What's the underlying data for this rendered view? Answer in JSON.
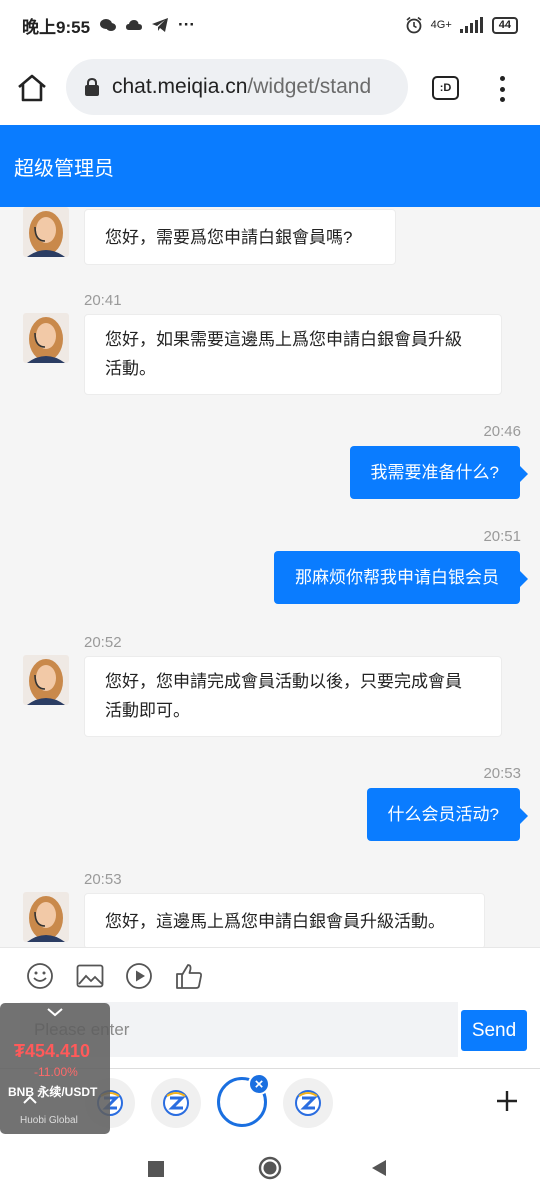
{
  "status_bar": {
    "time": "晚上9:55",
    "ellipsis": "···",
    "network": "4G+",
    "battery": "44",
    "icons": [
      "wechat-icon",
      "cloud-icon",
      "telegram-icon",
      "alarm-icon",
      "signal-icon",
      "battery-icon"
    ]
  },
  "browser": {
    "url_host": "chat.meiqia.cn",
    "url_path": "/widget/stand",
    "tab_button_label": ":D"
  },
  "header": {
    "title": "超级管理员"
  },
  "messages": [
    {
      "direction": "in",
      "time": "",
      "text": "您好，需要爲您申請白銀會員嗎?"
    },
    {
      "direction": "in",
      "time": "20:41",
      "lines": [
        "您好，如果需要這邊馬上爲您申請白銀會員升級",
        "活動。"
      ]
    },
    {
      "direction": "out",
      "time": "20:46",
      "text": "我需要准备什么?"
    },
    {
      "direction": "out",
      "time": "20:51",
      "text": "那麻烦你帮我申请白银会员"
    },
    {
      "direction": "in",
      "time": "20:52",
      "lines": [
        "您好，您申請完成會員活動以後，只要完成會員",
        "活動即可。"
      ]
    },
    {
      "direction": "out",
      "time": "20:53",
      "text": "什么会员活动?"
    },
    {
      "direction": "in",
      "time": "20:53",
      "text": "您好，這邊馬上爲您申請白銀會員升級活動。"
    }
  ],
  "composer": {
    "placeholder": "Please enter",
    "send_label": "Send",
    "tools": [
      "emoji-icon",
      "image-icon",
      "video-icon",
      "thumbs-up-icon"
    ]
  },
  "ticker_widget": {
    "price": "₮454.410",
    "change": "-11.00%",
    "pair": "BNB 永续/USDT",
    "brand": "Huobi Global"
  },
  "colors": {
    "accent": "#0a7cff",
    "ticker_red": "#ff5a5a"
  }
}
